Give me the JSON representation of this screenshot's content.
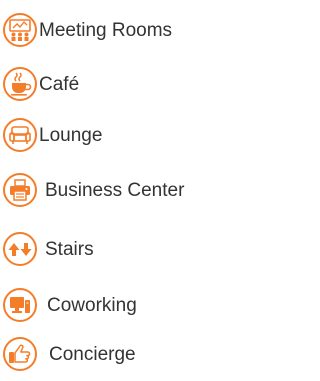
{
  "accent_color": "#f47d2a",
  "text_color": "#333333",
  "legend": {
    "items": [
      {
        "label": "Meeting Rooms",
        "icon": "meeting-rooms-icon"
      },
      {
        "label": "Café",
        "icon": "cafe-cup-icon"
      },
      {
        "label": "Lounge",
        "icon": "lounge-chair-icon"
      },
      {
        "label": "Business Center",
        "icon": "printer-icon"
      },
      {
        "label": "Stairs",
        "icon": "stairs-arrows-icon"
      },
      {
        "label": "Coworking",
        "icon": "coworking-computer-icon"
      },
      {
        "label": "Concierge",
        "icon": "concierge-hand-icon"
      }
    ]
  }
}
